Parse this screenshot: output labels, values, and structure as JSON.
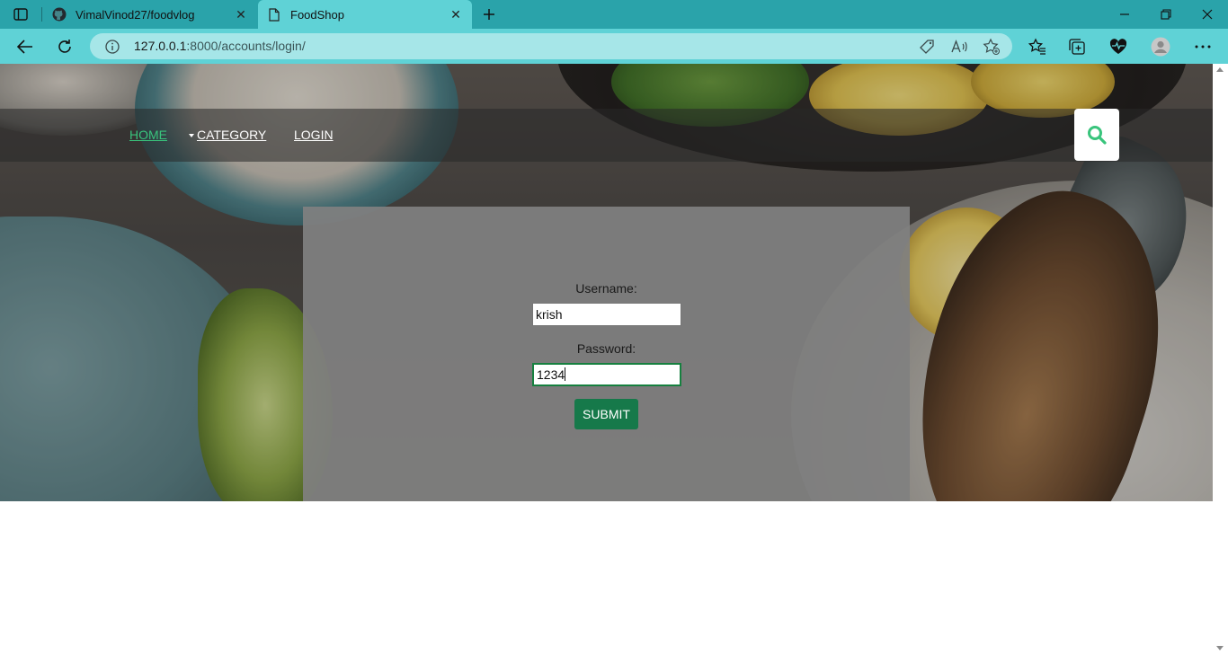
{
  "browser": {
    "tabs": [
      {
        "title": "VimalVinod27/foodvlog",
        "favicon": "github-icon",
        "active": false
      },
      {
        "title": "FoodShop",
        "favicon": "page-icon",
        "active": true
      }
    ],
    "url_host": "127.0.0.1",
    "url_rest": ":8000/accounts/login/",
    "accent": "#5fd2d6"
  },
  "site": {
    "nav": {
      "home": "HOME",
      "category": "CATEGORY",
      "login": "LOGIN"
    },
    "accent": "#39c47c"
  },
  "login": {
    "username_label": "Username:",
    "username_value": "krish",
    "password_label": "Password:",
    "password_value": "1234",
    "submit_label": "SUBMIT",
    "button_color": "#16794a"
  }
}
